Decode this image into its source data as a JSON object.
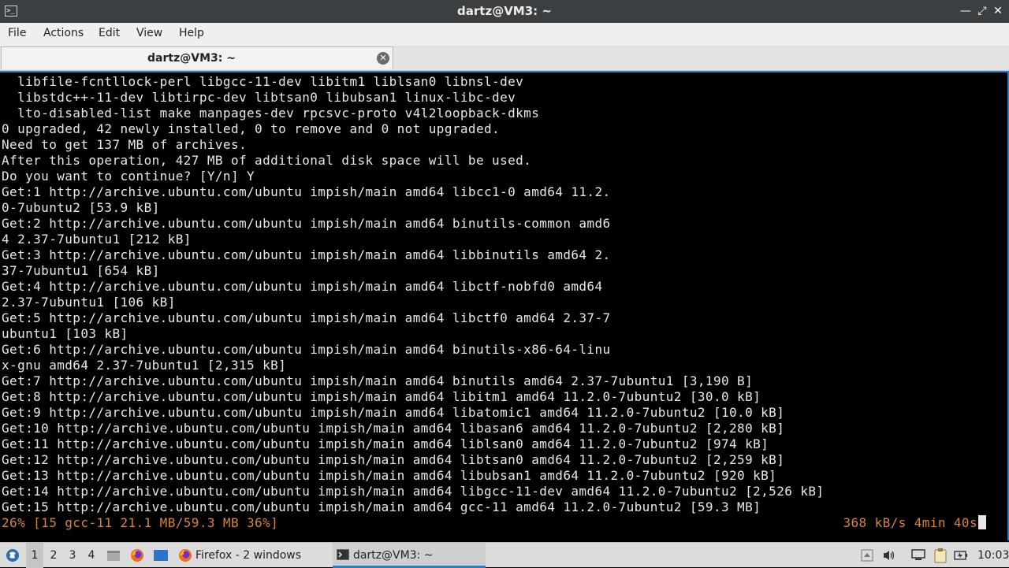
{
  "window": {
    "title": "dartz@VM3: ~",
    "app_icon_glyph": ">_",
    "minimize_glyph": "—",
    "maximize_glyph": "⤢",
    "close_glyph": "✕"
  },
  "menu": {
    "file": "File",
    "actions": "Actions",
    "edit": "Edit",
    "view": "View",
    "help": "Help"
  },
  "tab": {
    "label": "dartz@VM3: ~",
    "close_glyph": "✕"
  },
  "terminal": {
    "lines": [
      "  libfile-fcntllock-perl libgcc-11-dev libitm1 liblsan0 libnsl-dev",
      "  libstdc++-11-dev libtirpc-dev libtsan0 libubsan1 linux-libc-dev",
      "  lto-disabled-list make manpages-dev rpcsvc-proto v4l2loopback-dkms",
      "0 upgraded, 42 newly installed, 0 to remove and 0 not upgraded.",
      "Need to get 137 MB of archives.",
      "After this operation, 427 MB of additional disk space will be used.",
      "Do you want to continue? [Y/n] Y",
      "Get:1 http://archive.ubuntu.com/ubuntu impish/main amd64 libcc1-0 amd64 11.2.",
      "0-7ubuntu2 [53.9 kB]",
      "Get:2 http://archive.ubuntu.com/ubuntu impish/main amd64 binutils-common amd6",
      "4 2.37-7ubuntu1 [212 kB]",
      "Get:3 http://archive.ubuntu.com/ubuntu impish/main amd64 libbinutils amd64 2.",
      "37-7ubuntu1 [654 kB]",
      "Get:4 http://archive.ubuntu.com/ubuntu impish/main amd64 libctf-nobfd0 amd64",
      "2.37-7ubuntu1 [106 kB]",
      "Get:5 http://archive.ubuntu.com/ubuntu impish/main amd64 libctf0 amd64 2.37-7",
      "ubuntu1 [103 kB]",
      "Get:6 http://archive.ubuntu.com/ubuntu impish/main amd64 binutils-x86-64-linu",
      "x-gnu amd64 2.37-7ubuntu1 [2,315 kB]",
      "Get:7 http://archive.ubuntu.com/ubuntu impish/main amd64 binutils amd64 2.37-7ubuntu1 [3,190 B]",
      "Get:8 http://archive.ubuntu.com/ubuntu impish/main amd64 libitm1 amd64 11.2.0-7ubuntu2 [30.0 kB]",
      "Get:9 http://archive.ubuntu.com/ubuntu impish/main amd64 libatomic1 amd64 11.2.0-7ubuntu2 [10.0 kB]",
      "Get:10 http://archive.ubuntu.com/ubuntu impish/main amd64 libasan6 amd64 11.2.0-7ubuntu2 [2,280 kB]",
      "Get:11 http://archive.ubuntu.com/ubuntu impish/main amd64 liblsan0 amd64 11.2.0-7ubuntu2 [974 kB]",
      "Get:12 http://archive.ubuntu.com/ubuntu impish/main amd64 libtsan0 amd64 11.2.0-7ubuntu2 [2,259 kB]",
      "Get:13 http://archive.ubuntu.com/ubuntu impish/main amd64 libubsan1 amd64 11.2.0-7ubuntu2 [920 kB]",
      "Get:14 http://archive.ubuntu.com/ubuntu impish/main amd64 libgcc-11-dev amd64 11.2.0-7ubuntu2 [2,526 kB]",
      "Get:15 http://archive.ubuntu.com/ubuntu impish/main amd64 gcc-11 amd64 11.2.0-7ubuntu2 [59.3 MB]"
    ],
    "progress_left": "26% [15 gcc-11 21.1 MB/59.3 MB 36%]",
    "progress_right": "368 kB/s 4min 40s",
    "text_color": "#e8e8e8",
    "progress_color": "#d0863c",
    "accent": "#2f7bbf"
  },
  "taskbar": {
    "workspaces": [
      "1",
      "2",
      "3",
      "4"
    ],
    "active_workspace": "1",
    "firefox_window": "Firefox - 2 windows",
    "terminal_window": "dartz@VM3: ~",
    "clock": "10:03",
    "icons": [
      "start-menu-icon",
      "file-manager-icon",
      "firefox-icon",
      "show-desktop-icon",
      "tray-arrow-icon",
      "volume-icon",
      "network-icon",
      "clipboard-icon",
      "power-icon"
    ]
  }
}
